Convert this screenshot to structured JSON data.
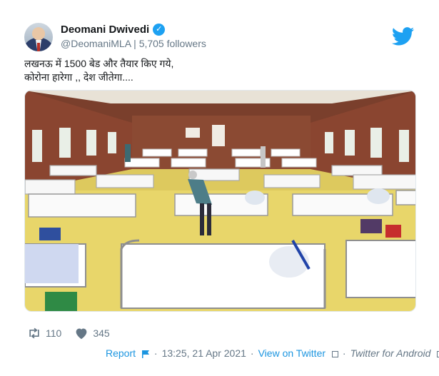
{
  "tweet": {
    "author_name": "Deomani Dwivedi",
    "handle": "@DeomaniMLA",
    "followers": "5,705 followers",
    "separator": "|",
    "text_line1": "लखनऊ में 1500 बेड और तैयार किए गये,",
    "text_line2": "कोरोना हारेगा ,, देश जीतेगा....",
    "retweets": "110",
    "likes": "345",
    "report_label": "Report",
    "timestamp": "13:25, 21 Apr 2021",
    "view_on_twitter": "View on Twitter",
    "source": "Twitter for Android",
    "dot": "·"
  },
  "icons": {
    "verified": "verified-badge-icon",
    "bird": "twitter-bird-icon",
    "retweet": "retweet-icon",
    "like": "heart-icon",
    "report": "flag-icon",
    "external": "external-link-icon"
  },
  "colors": {
    "twitter_blue": "#1da1f2",
    "link_blue": "#1b95e0",
    "muted_gray": "#657786",
    "text_dark": "#14171a"
  }
}
